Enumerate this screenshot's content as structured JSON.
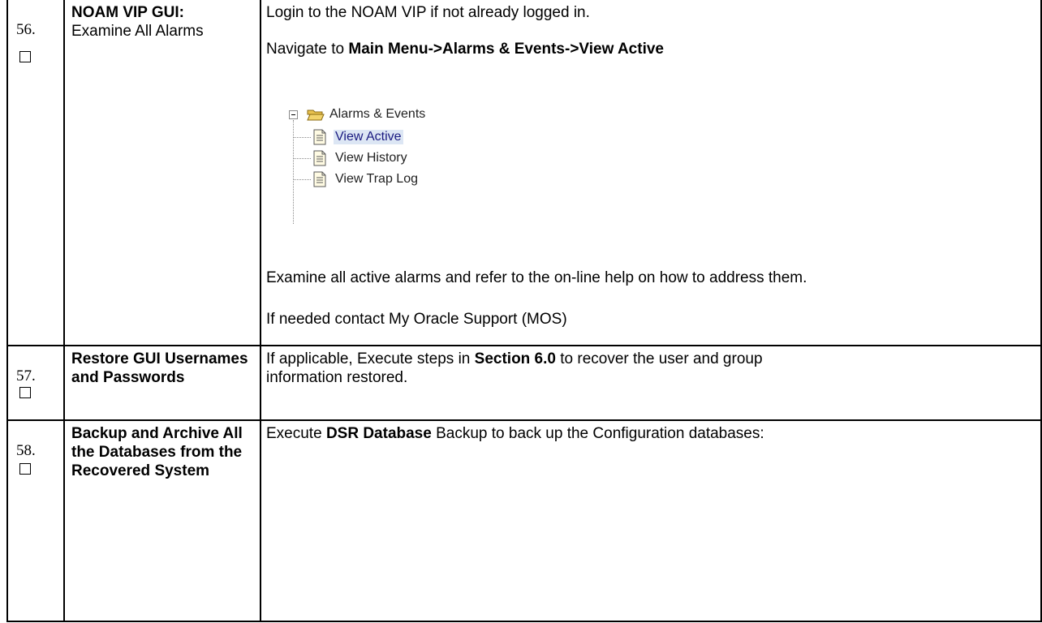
{
  "rows": [
    {
      "number": "56.",
      "step_title_bold": "NOAM VIP GUI:",
      "step_title_rest": "Examine All Alarms",
      "desc": {
        "line1": "Login to the NOAM VIP if not already logged in.",
        "nav_prefix": "Navigate to ",
        "nav_bold": "Main Menu->Alarms & Events->View Active",
        "tree": {
          "root_label": "Alarms & Events",
          "items": [
            "View Active",
            "View History",
            "View Trap Log"
          ],
          "selected_index": 0
        },
        "line_examine": "Examine all active alarms and refer to the on-line help on how to address them.",
        "line_contact": "If needed contact My Oracle Support (MOS)"
      }
    },
    {
      "number": "57.",
      "step_title_bold": "Restore GUI Usernames and Passwords",
      "desc": {
        "prefix": "If applicable, Execute steps in ",
        "bold": "Section 6.0",
        "suffix": " to recover the user and group",
        "line2": "information restored."
      }
    },
    {
      "number": "58.",
      "step_title_bold": "Backup and Archive All the Databases from the Recovered System",
      "desc": {
        "prefix": "Execute ",
        "bold": "DSR Database",
        "suffix": " Backup to back up the Configuration databases:"
      }
    }
  ],
  "colors": {
    "border": "#000000",
    "selected_bg": "#dce6f4",
    "folder_fill": "#f2d36b"
  }
}
